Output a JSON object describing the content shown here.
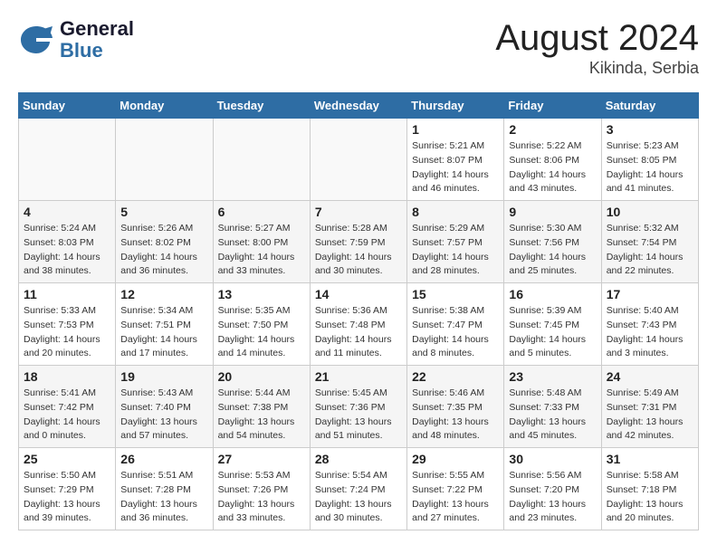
{
  "header": {
    "logo_line1": "General",
    "logo_line2": "Blue",
    "month": "August 2024",
    "location": "Kikinda, Serbia"
  },
  "weekdays": [
    "Sunday",
    "Monday",
    "Tuesday",
    "Wednesday",
    "Thursday",
    "Friday",
    "Saturday"
  ],
  "weeks": [
    [
      {
        "day": "",
        "info": ""
      },
      {
        "day": "",
        "info": ""
      },
      {
        "day": "",
        "info": ""
      },
      {
        "day": "",
        "info": ""
      },
      {
        "day": "1",
        "info": "Sunrise: 5:21 AM\nSunset: 8:07 PM\nDaylight: 14 hours\nand 46 minutes."
      },
      {
        "day": "2",
        "info": "Sunrise: 5:22 AM\nSunset: 8:06 PM\nDaylight: 14 hours\nand 43 minutes."
      },
      {
        "day": "3",
        "info": "Sunrise: 5:23 AM\nSunset: 8:05 PM\nDaylight: 14 hours\nand 41 minutes."
      }
    ],
    [
      {
        "day": "4",
        "info": "Sunrise: 5:24 AM\nSunset: 8:03 PM\nDaylight: 14 hours\nand 38 minutes."
      },
      {
        "day": "5",
        "info": "Sunrise: 5:26 AM\nSunset: 8:02 PM\nDaylight: 14 hours\nand 36 minutes."
      },
      {
        "day": "6",
        "info": "Sunrise: 5:27 AM\nSunset: 8:00 PM\nDaylight: 14 hours\nand 33 minutes."
      },
      {
        "day": "7",
        "info": "Sunrise: 5:28 AM\nSunset: 7:59 PM\nDaylight: 14 hours\nand 30 minutes."
      },
      {
        "day": "8",
        "info": "Sunrise: 5:29 AM\nSunset: 7:57 PM\nDaylight: 14 hours\nand 28 minutes."
      },
      {
        "day": "9",
        "info": "Sunrise: 5:30 AM\nSunset: 7:56 PM\nDaylight: 14 hours\nand 25 minutes."
      },
      {
        "day": "10",
        "info": "Sunrise: 5:32 AM\nSunset: 7:54 PM\nDaylight: 14 hours\nand 22 minutes."
      }
    ],
    [
      {
        "day": "11",
        "info": "Sunrise: 5:33 AM\nSunset: 7:53 PM\nDaylight: 14 hours\nand 20 minutes."
      },
      {
        "day": "12",
        "info": "Sunrise: 5:34 AM\nSunset: 7:51 PM\nDaylight: 14 hours\nand 17 minutes."
      },
      {
        "day": "13",
        "info": "Sunrise: 5:35 AM\nSunset: 7:50 PM\nDaylight: 14 hours\nand 14 minutes."
      },
      {
        "day": "14",
        "info": "Sunrise: 5:36 AM\nSunset: 7:48 PM\nDaylight: 14 hours\nand 11 minutes."
      },
      {
        "day": "15",
        "info": "Sunrise: 5:38 AM\nSunset: 7:47 PM\nDaylight: 14 hours\nand 8 minutes."
      },
      {
        "day": "16",
        "info": "Sunrise: 5:39 AM\nSunset: 7:45 PM\nDaylight: 14 hours\nand 5 minutes."
      },
      {
        "day": "17",
        "info": "Sunrise: 5:40 AM\nSunset: 7:43 PM\nDaylight: 14 hours\nand 3 minutes."
      }
    ],
    [
      {
        "day": "18",
        "info": "Sunrise: 5:41 AM\nSunset: 7:42 PM\nDaylight: 14 hours\nand 0 minutes."
      },
      {
        "day": "19",
        "info": "Sunrise: 5:43 AM\nSunset: 7:40 PM\nDaylight: 13 hours\nand 57 minutes."
      },
      {
        "day": "20",
        "info": "Sunrise: 5:44 AM\nSunset: 7:38 PM\nDaylight: 13 hours\nand 54 minutes."
      },
      {
        "day": "21",
        "info": "Sunrise: 5:45 AM\nSunset: 7:36 PM\nDaylight: 13 hours\nand 51 minutes."
      },
      {
        "day": "22",
        "info": "Sunrise: 5:46 AM\nSunset: 7:35 PM\nDaylight: 13 hours\nand 48 minutes."
      },
      {
        "day": "23",
        "info": "Sunrise: 5:48 AM\nSunset: 7:33 PM\nDaylight: 13 hours\nand 45 minutes."
      },
      {
        "day": "24",
        "info": "Sunrise: 5:49 AM\nSunset: 7:31 PM\nDaylight: 13 hours\nand 42 minutes."
      }
    ],
    [
      {
        "day": "25",
        "info": "Sunrise: 5:50 AM\nSunset: 7:29 PM\nDaylight: 13 hours\nand 39 minutes."
      },
      {
        "day": "26",
        "info": "Sunrise: 5:51 AM\nSunset: 7:28 PM\nDaylight: 13 hours\nand 36 minutes."
      },
      {
        "day": "27",
        "info": "Sunrise: 5:53 AM\nSunset: 7:26 PM\nDaylight: 13 hours\nand 33 minutes."
      },
      {
        "day": "28",
        "info": "Sunrise: 5:54 AM\nSunset: 7:24 PM\nDaylight: 13 hours\nand 30 minutes."
      },
      {
        "day": "29",
        "info": "Sunrise: 5:55 AM\nSunset: 7:22 PM\nDaylight: 13 hours\nand 27 minutes."
      },
      {
        "day": "30",
        "info": "Sunrise: 5:56 AM\nSunset: 7:20 PM\nDaylight: 13 hours\nand 23 minutes."
      },
      {
        "day": "31",
        "info": "Sunrise: 5:58 AM\nSunset: 7:18 PM\nDaylight: 13 hours\nand 20 minutes."
      }
    ]
  ]
}
